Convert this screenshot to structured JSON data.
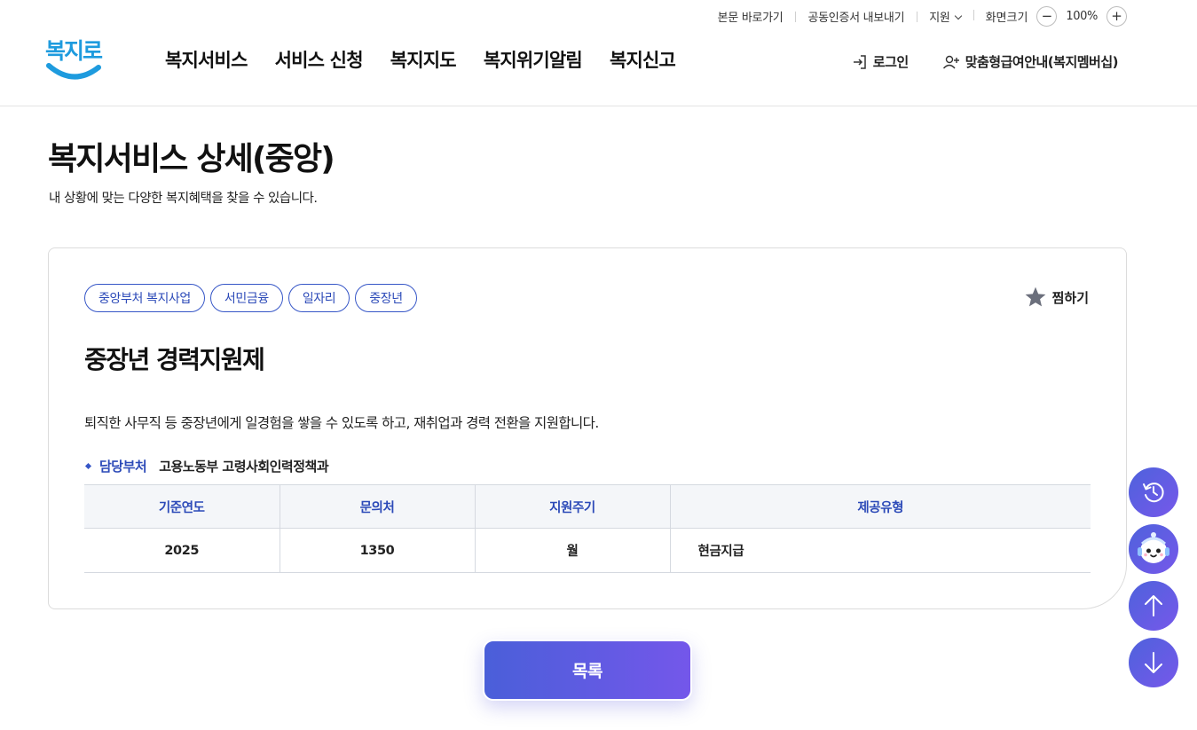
{
  "utility": {
    "skip_to_content": "본문 바로가기",
    "export_cert": "공동인증서 내보내기",
    "support": "지원",
    "screen_size_label": "화면크기",
    "zoom_minus": "−",
    "zoom_value": "100%",
    "zoom_plus": "+"
  },
  "header": {
    "logo_text": "복지로",
    "nav": [
      "복지서비스",
      "서비스 신청",
      "복지지도",
      "복지위기알림",
      "복지신고"
    ],
    "login": "로그인",
    "membership": "맞춤형급여안내(복지멤버십)"
  },
  "page": {
    "title": "복지서비스 상세(중앙)",
    "subtitle": "내 상황에 맞는 다양한 복지혜택을 찾을 수 있습니다."
  },
  "service": {
    "tags": [
      "중앙부처 복지사업",
      "서민금융",
      "일자리",
      "중장년"
    ],
    "bookmark": "찜하기",
    "title": "중장년 경력지원제",
    "description": "퇴직한 사무직 등 중장년에게 일경험을 쌓을 수 있도록 하고, 재취업과 경력 전환을 지원합니다.",
    "department_label": "담당부처",
    "department_value": "고용노동부 고령사회인력정책과",
    "table": {
      "headers": [
        "기준연도",
        "문의처",
        "지원주기",
        "제공유형"
      ],
      "row": [
        "2025",
        "1350",
        "월",
        "현금지급"
      ]
    }
  },
  "list_button": "목록",
  "colors": {
    "brand_blue": "#2c4ab8",
    "button_gradient_start": "#4a5fd9",
    "button_gradient_end": "#7457ea",
    "logo_blue": "#1e9bde"
  },
  "icons": {
    "login": "login-icon",
    "membership": "user-plus-icon",
    "bookmark": "star-icon",
    "recent": "history-icon",
    "chatbot": "chatbot-icon",
    "scroll_top": "arrow-up-icon",
    "scroll_bottom": "arrow-down-icon"
  }
}
